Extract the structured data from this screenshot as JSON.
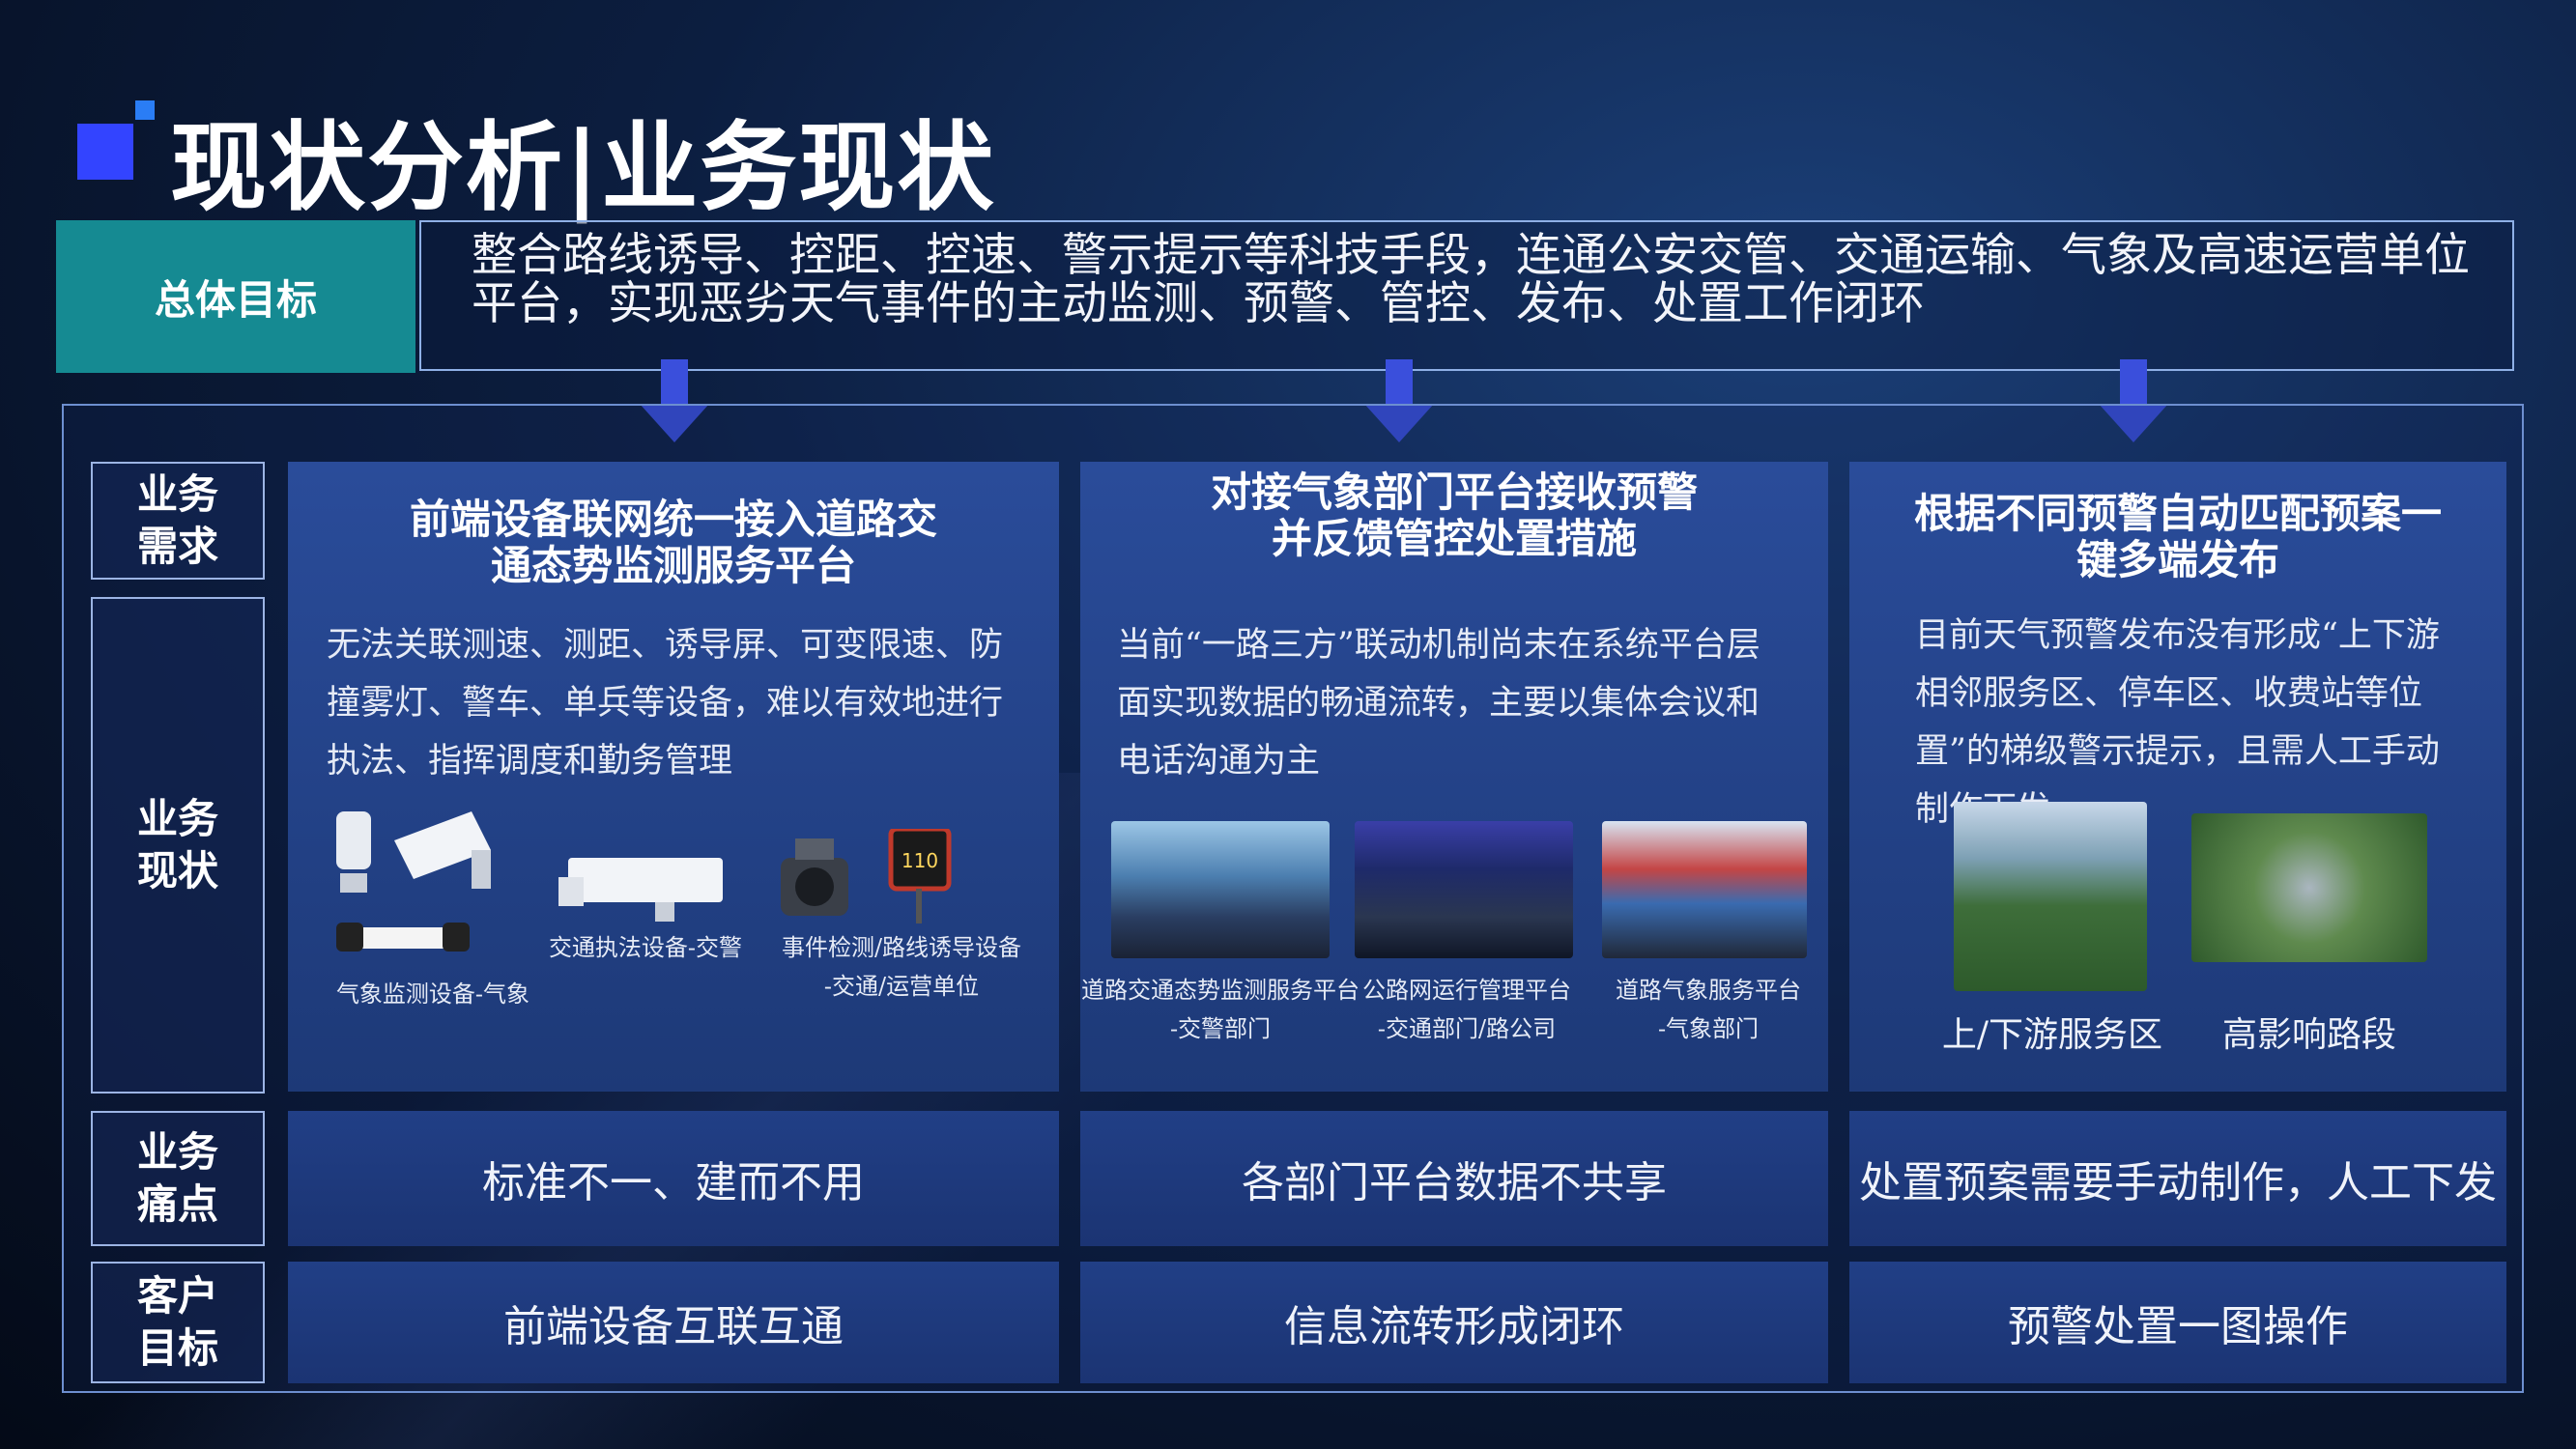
{
  "page": {
    "title": "现状分析|业务现状"
  },
  "goal": {
    "label": "总体目标",
    "text": "整合路线诱导、控距、控速、警示提示等科技手段，连通公安交管、交通运输、气象及高速运营单位平台，实现恶劣天气事件的主动监测、预警、管控、发布、处置工作闭环"
  },
  "row_labels": {
    "demand": "业务需求",
    "status": "业务现状",
    "pain": "业务痛点",
    "target": "客户目标"
  },
  "columns": [
    {
      "demand": "前端设备联网统一接入道路交通态势监测服务平台",
      "status": "无法关联测速、测距、诱导屏、可变限速、防撞雾灯、警车、单兵等设备，难以有效地进行执法、指挥调度和勤务管理",
      "captions": [
        "气象监测设备-气象",
        "交通执法设备-交警",
        "事件检测/路线诱导设备",
        "-交通/运营单位"
      ],
      "sign_text": "110",
      "pain": "标准不一、建而不用",
      "target": "前端设备互联互通"
    },
    {
      "demand": "对接气象部门平台接收预警并反馈管控处置措施",
      "status": "当前“一路三方”联动机制尚未在系统平台层面实现数据的畅通流转，主要以集体会议和电话沟通为主",
      "captions": [
        {
          "line1": "道路交通态势监测服务平台",
          "line2": "-交警部门"
        },
        {
          "line1": "公路网运行管理平台",
          "line2": "-交通部门/路公司"
        },
        {
          "line1": "道路气象服务平台",
          "line2": "-气象部门"
        }
      ],
      "pain": "各部门平台数据不共享",
      "target": "信息流转形成闭环"
    },
    {
      "demand": "根据不同预警自动匹配预案一键多端发布",
      "status": "目前天气预警发布没有形成“上下游相邻服务区、停车区、收费站等位置”的梯级警示提示，且需人工手动制作下发",
      "captions": [
        "上/下游服务区",
        "高影响路段"
      ],
      "pain": "处置预案需要手动制作，人工下发",
      "target": "预警处置一图操作"
    }
  ],
  "colors": {
    "accent": "#3344ff",
    "goal_label_bg": "#158a92",
    "panel": "#24458c",
    "arrow": "#3a4fdc"
  }
}
